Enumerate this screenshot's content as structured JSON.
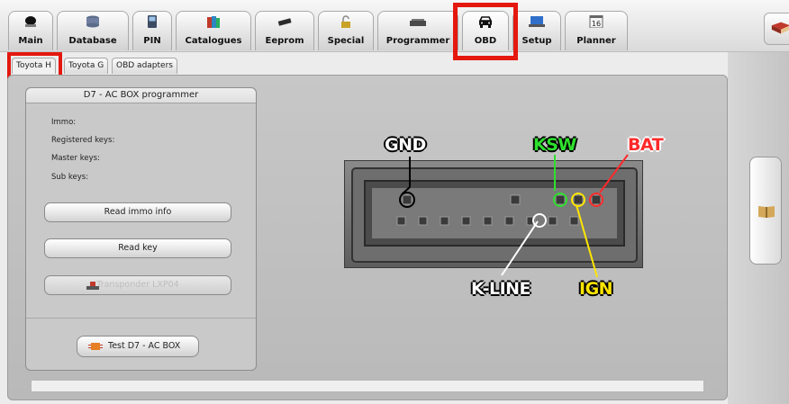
{
  "toolbar": {
    "items": [
      {
        "label": "Main",
        "icon": "main-icon"
      },
      {
        "label": "Database",
        "icon": "database-icon"
      },
      {
        "label": "PIN",
        "icon": "pin-icon"
      },
      {
        "label": "Catalogues",
        "icon": "catalogues-icon"
      },
      {
        "label": "Eeprom",
        "icon": "eeprom-icon"
      },
      {
        "label": "Special",
        "icon": "special-icon"
      },
      {
        "label": "Programmer",
        "icon": "programmer-icon"
      },
      {
        "label": "OBD",
        "icon": "car-icon"
      },
      {
        "label": "Setup",
        "icon": "setup-icon"
      },
      {
        "label": "Planner",
        "icon": "planner-icon"
      }
    ],
    "planner_day": "16"
  },
  "subtabs": [
    "Toyota H",
    "Toyota G",
    "OBD adapters"
  ],
  "d7": {
    "title": "D7 - AC BOX programmer",
    "labels": {
      "immo": "Immo:",
      "registered": "Registered keys:",
      "master": "Master keys:",
      "sub": "Sub keys:"
    },
    "buttons": {
      "read_immo": "Read immo info",
      "read_key": "Read key",
      "transponder": "Transponder LXP04",
      "test": "Test D7 - AC BOX"
    }
  },
  "connector": {
    "gnd": "GND",
    "ksw": "KSW",
    "bat": "BAT",
    "kline": "K-LINE",
    "ign": "IGN"
  },
  "colors": {
    "highlight": "#e4180f",
    "ksw": "#2ee02e",
    "bat": "#ff2a2a",
    "ign": "#ffe600",
    "gnd": "#ffffff",
    "kline": "#ffffff"
  }
}
